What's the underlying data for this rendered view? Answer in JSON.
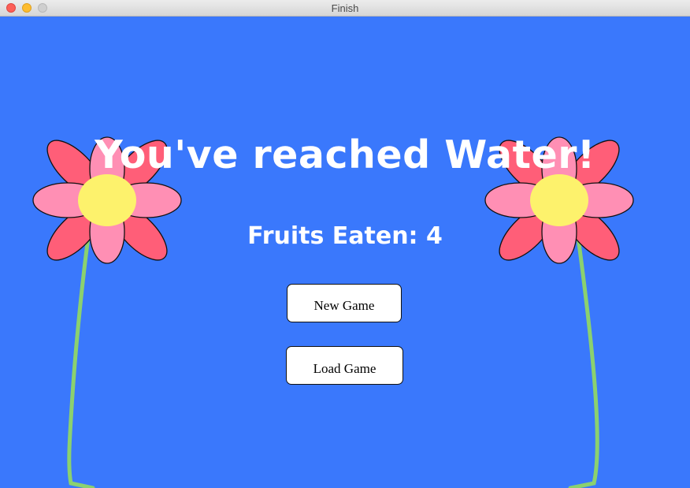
{
  "window": {
    "title": "Finish",
    "background": "#3a78fc"
  },
  "message": {
    "headline": "You've reached Water!",
    "fruits_eaten": "Fruits Eaten: 4"
  },
  "buttons": {
    "new_game": "New Game",
    "load_game": "Load Game"
  },
  "decor": {
    "petal_outer_color": "#ff5e78",
    "petal_inner_color": "#ff8fb4",
    "center_color": "#fdf26c",
    "stem_color": "#8bd16f"
  }
}
